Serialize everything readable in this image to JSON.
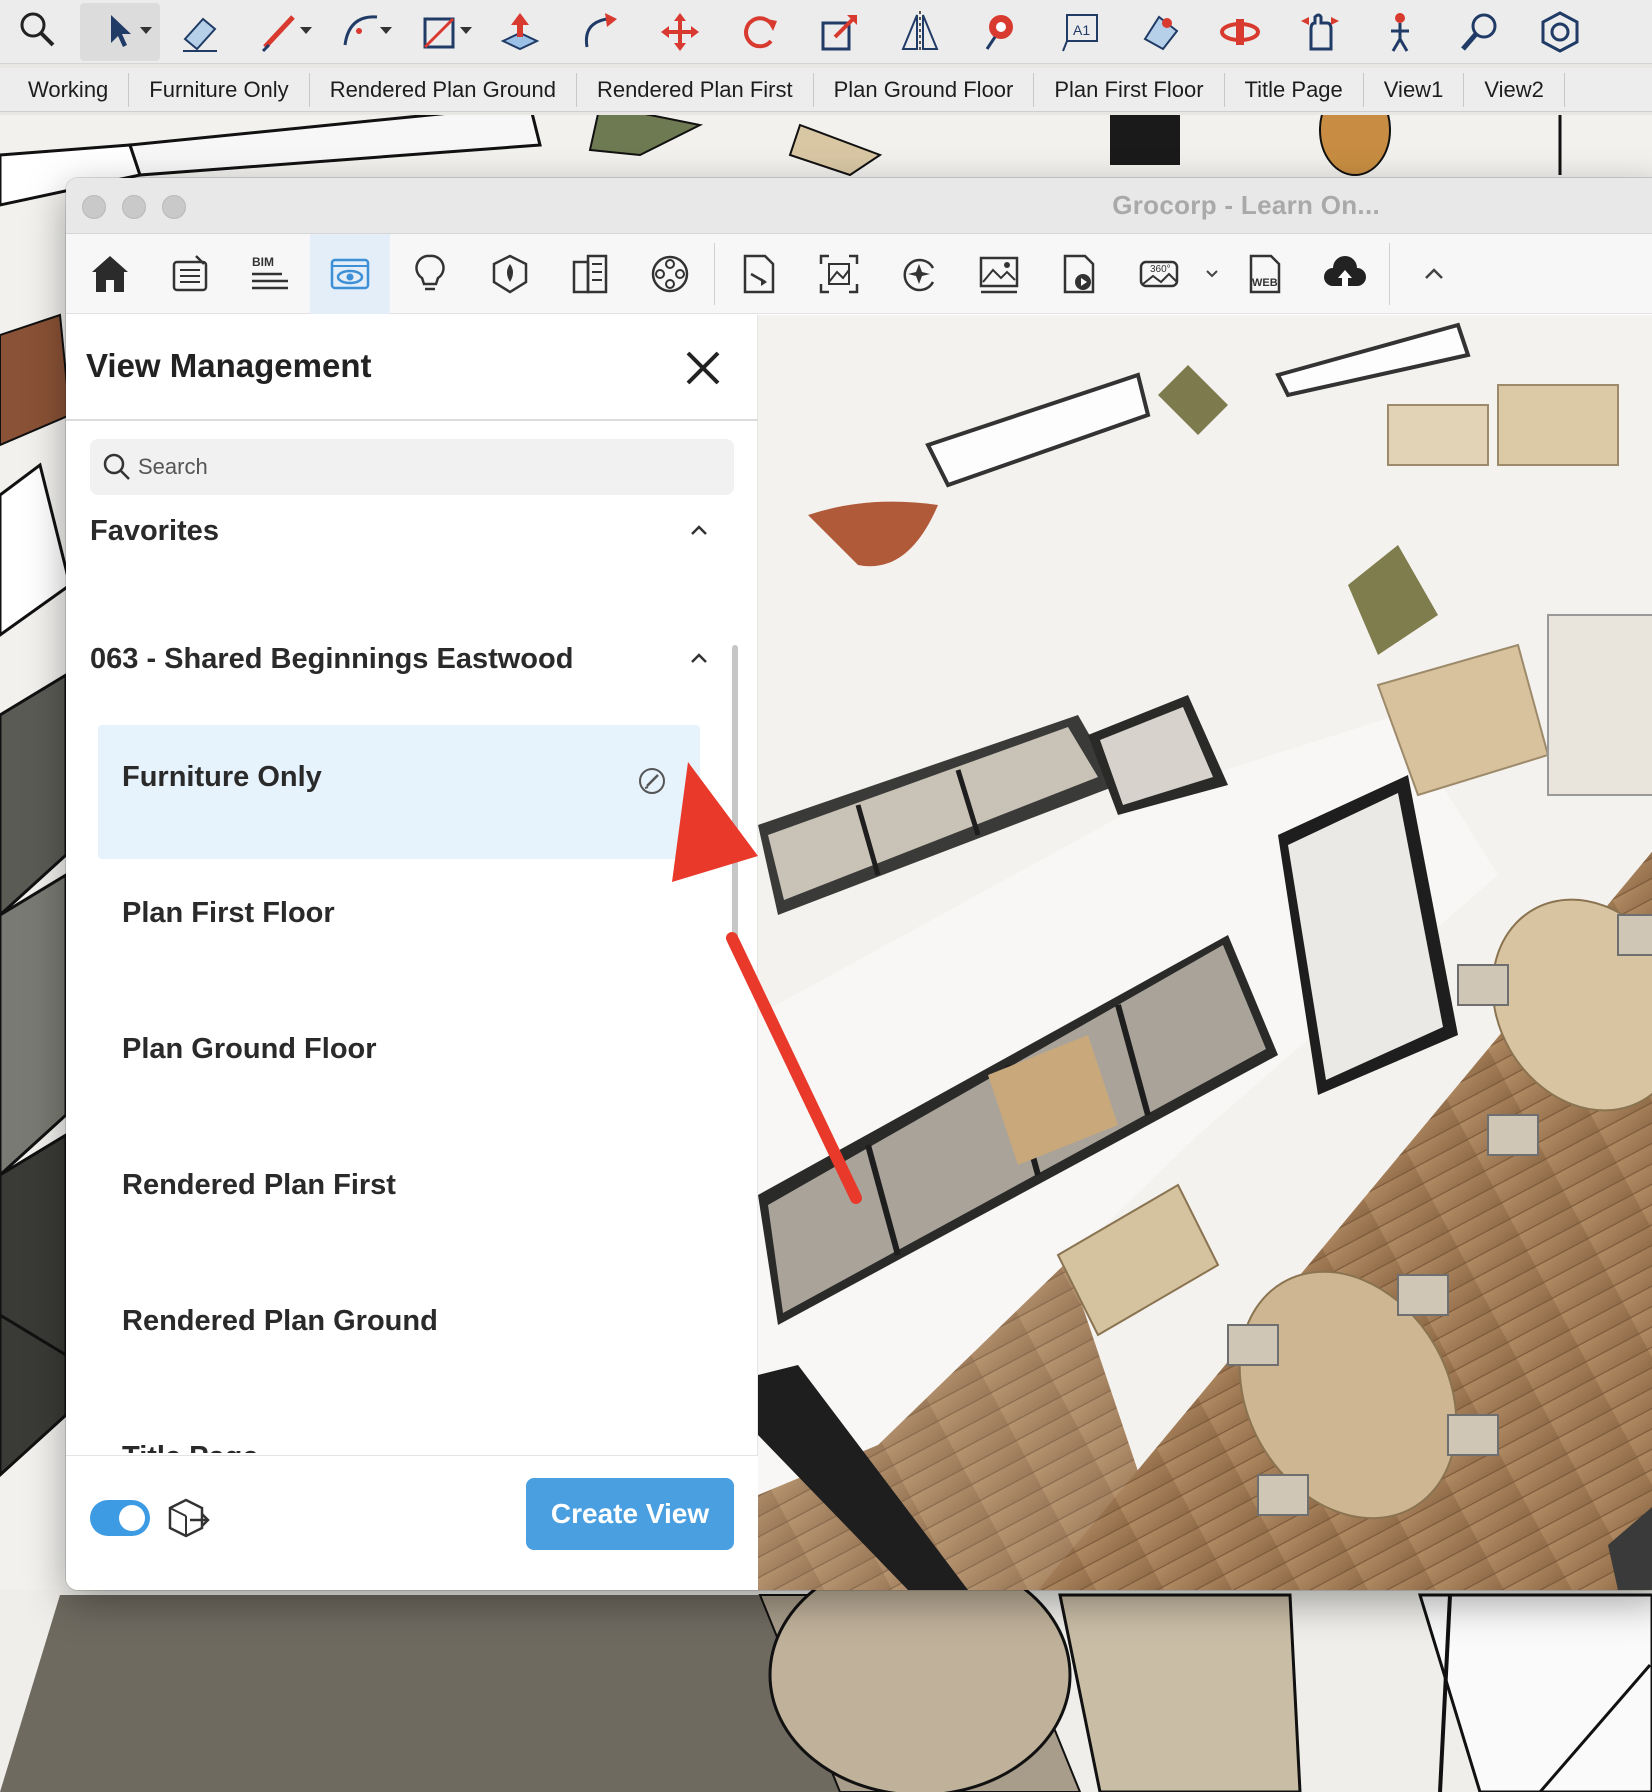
{
  "su_toolbar": {
    "tools": [
      {
        "icon": "search-icon"
      },
      {
        "icon": "select-arrow-icon",
        "selected": true,
        "dropdown": true
      },
      {
        "icon": "eraser-icon"
      },
      {
        "icon": "pencil-icon",
        "dropdown": true
      },
      {
        "icon": "arc-icon",
        "dropdown": true
      },
      {
        "icon": "rectangle-icon",
        "dropdown": true
      },
      {
        "icon": "push-pull-icon"
      },
      {
        "icon": "follow-me-icon"
      },
      {
        "icon": "move-icon"
      },
      {
        "icon": "rotate-icon"
      },
      {
        "icon": "scale-icon"
      },
      {
        "icon": "flip-icon"
      },
      {
        "icon": "paint-bucket-icon"
      },
      {
        "icon": "text-icon"
      },
      {
        "icon": "orbit-icon"
      },
      {
        "icon": "pan-icon"
      },
      {
        "icon": "walk-icon"
      },
      {
        "icon": "position-camera-icon"
      },
      {
        "icon": "zoom-icon"
      },
      {
        "icon": "extension-icon"
      }
    ]
  },
  "scene_tabs": [
    "Working",
    "Furniture Only",
    "Rendered Plan Ground",
    "Rendered Plan First",
    "Plan Ground Floor",
    "Plan First Floor",
    "Title Page",
    "View1",
    "View2"
  ],
  "window": {
    "title": "Grocorp - Learn On..."
  },
  "plugin_toolbar": {
    "bim_label": "BIM",
    "web_label": "WEB",
    "pano_label": "360°"
  },
  "view_management": {
    "title": "View Management",
    "search_placeholder": "Search",
    "favorites_label": "Favorites",
    "project_label": "063 - Shared Beginnings Eastwood",
    "views": [
      {
        "name": "Furniture Only",
        "selected": true
      },
      {
        "name": "Plan First Floor"
      },
      {
        "name": "Plan Ground Floor"
      },
      {
        "name": "Rendered Plan First"
      },
      {
        "name": "Rendered Plan Ground"
      },
      {
        "name": "Title Page"
      }
    ],
    "toggle_on": true,
    "create_button": "Create View"
  },
  "colors": {
    "accent": "#4a9fe0",
    "selected_row": "#e6f2fc",
    "annotation_arrow": "#e8392b"
  }
}
